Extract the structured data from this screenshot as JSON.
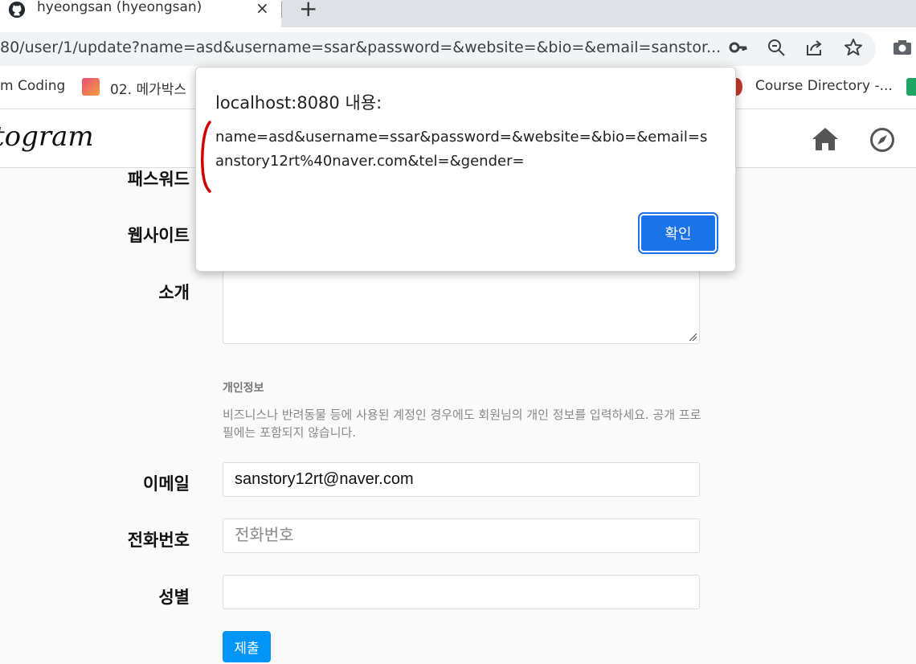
{
  "browser": {
    "tab_title": "hyeongsan (hyeongsan)",
    "close_glyph": "×",
    "newtab_glyph": "+",
    "url": "80/user/1/update?name=asd&username=ssar&password=&website=&bio=&email=sanstor...",
    "bookmarks": [
      "m Coding",
      "02. 메가박스",
      "Course Directory -..."
    ]
  },
  "site": {
    "logo": "togram"
  },
  "form": {
    "password_label": "패스워드",
    "website_label": "웹사이트",
    "bio_label": "소개",
    "private_title": "개인정보",
    "private_desc": "비즈니스나 반려동물 등에 사용된 계정인 경우에도 회원님의 개인 정보를 입력하세요. 공개 프로필에는 포함되지 않습니다.",
    "email_label": "이메일",
    "email_value": "sanstory12rt@naver.com",
    "phone_label": "전화번호",
    "phone_placeholder": "전화번호",
    "gender_label": "성별",
    "gender_value": "",
    "submit_label": "제출"
  },
  "dialog": {
    "title": "localhost:8080 내용:",
    "message": "name=asd&username=ssar&password=&website=&bio=&email=sanstory12rt%40naver.com&tel=&gender=",
    "ok_label": "확인"
  },
  "colors": {
    "accent": "#0095f6",
    "dialog_button": "#1a73e8",
    "annotation": "#d00000"
  }
}
